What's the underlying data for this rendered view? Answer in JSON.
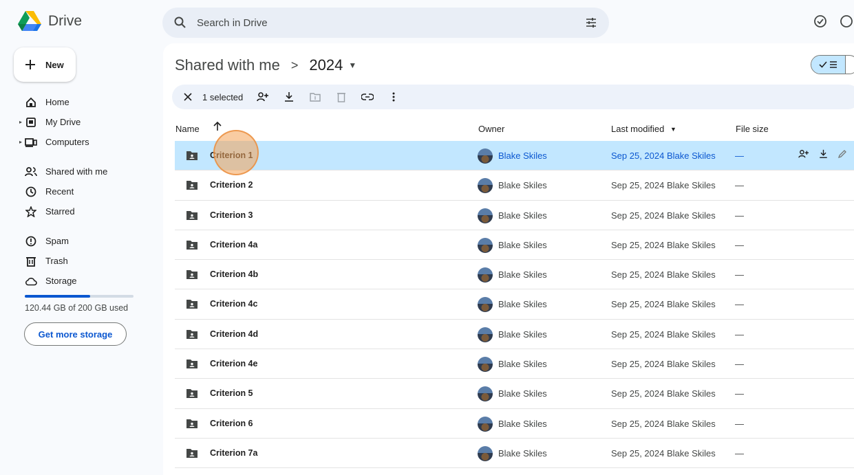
{
  "app": {
    "title": "Drive"
  },
  "search": {
    "placeholder": "Search in Drive"
  },
  "sidebar": {
    "new_label": "New",
    "items": [
      {
        "label": "Home",
        "icon": "home-icon"
      },
      {
        "label": "My Drive",
        "icon": "my-drive-icon"
      },
      {
        "label": "Computers",
        "icon": "computers-icon"
      },
      {
        "label": "Shared with me",
        "icon": "shared-icon"
      },
      {
        "label": "Recent",
        "icon": "clock-icon"
      },
      {
        "label": "Starred",
        "icon": "star-icon"
      },
      {
        "label": "Spam",
        "icon": "spam-icon"
      },
      {
        "label": "Trash",
        "icon": "trash-icon"
      },
      {
        "label": "Storage",
        "icon": "cloud-icon"
      }
    ],
    "storage_text": "120.44 GB of 200 GB used",
    "storage_fraction": 0.6022,
    "get_storage_label": "Get more storage"
  },
  "breadcrumb": {
    "parent": "Shared with me",
    "separator": ">",
    "current": "2024"
  },
  "selection": {
    "count_label": "1 selected"
  },
  "table": {
    "headers": {
      "name": "Name",
      "owner": "Owner",
      "modified": "Last modified",
      "size": "File size"
    },
    "rows": [
      {
        "name": "Criterion 1",
        "owner": "Blake Skiles",
        "modified": "Sep 25, 2024 Blake Skiles",
        "size": "—",
        "selected": true
      },
      {
        "name": "Criterion 2",
        "owner": "Blake Skiles",
        "modified": "Sep 25, 2024 Blake Skiles",
        "size": "—"
      },
      {
        "name": "Criterion 3",
        "owner": "Blake Skiles",
        "modified": "Sep 25, 2024 Blake Skiles",
        "size": "—"
      },
      {
        "name": "Criterion 4a",
        "owner": "Blake Skiles",
        "modified": "Sep 25, 2024 Blake Skiles",
        "size": "—"
      },
      {
        "name": "Criterion 4b",
        "owner": "Blake Skiles",
        "modified": "Sep 25, 2024 Blake Skiles",
        "size": "—"
      },
      {
        "name": "Criterion 4c",
        "owner": "Blake Skiles",
        "modified": "Sep 25, 2024 Blake Skiles",
        "size": "—"
      },
      {
        "name": "Criterion 4d",
        "owner": "Blake Skiles",
        "modified": "Sep 25, 2024 Blake Skiles",
        "size": "—"
      },
      {
        "name": "Criterion 4e",
        "owner": "Blake Skiles",
        "modified": "Sep 25, 2024 Blake Skiles",
        "size": "—"
      },
      {
        "name": "Criterion 5",
        "owner": "Blake Skiles",
        "modified": "Sep 25, 2024 Blake Skiles",
        "size": "—"
      },
      {
        "name": "Criterion 6",
        "owner": "Blake Skiles",
        "modified": "Sep 25, 2024 Blake Skiles",
        "size": "—"
      },
      {
        "name": "Criterion 7a",
        "owner": "Blake Skiles",
        "modified": "Sep 25, 2024 Blake Skiles",
        "size": "—"
      }
    ]
  },
  "colors": {
    "accent": "#0b57d0",
    "selected_row": "#c2e7ff",
    "search_bg": "#e9eef6"
  }
}
